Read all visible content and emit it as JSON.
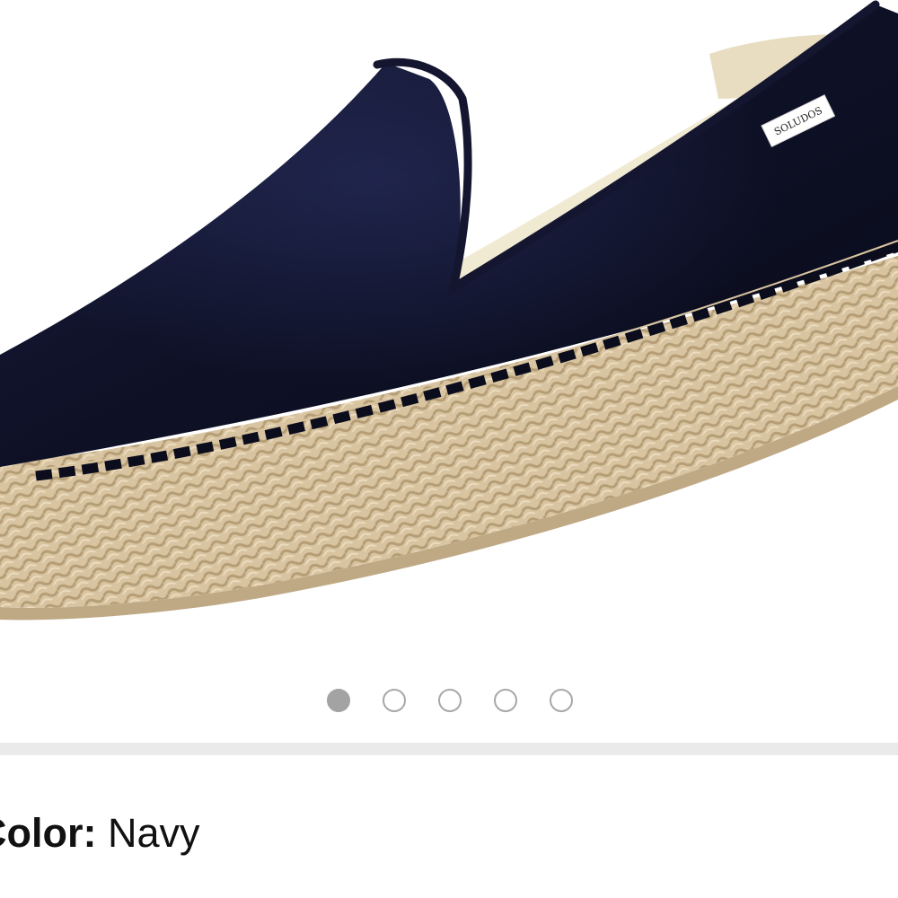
{
  "product": {
    "brand_tag": "SOLUDOS",
    "carousel": {
      "total": 5,
      "active_index": 0
    },
    "color_option": {
      "label": "Color:",
      "value": "Navy"
    },
    "colors": {
      "dot_active": "#a3a3a3",
      "dot_border": "#a8a8a8",
      "divider": "#eaeaea"
    }
  }
}
